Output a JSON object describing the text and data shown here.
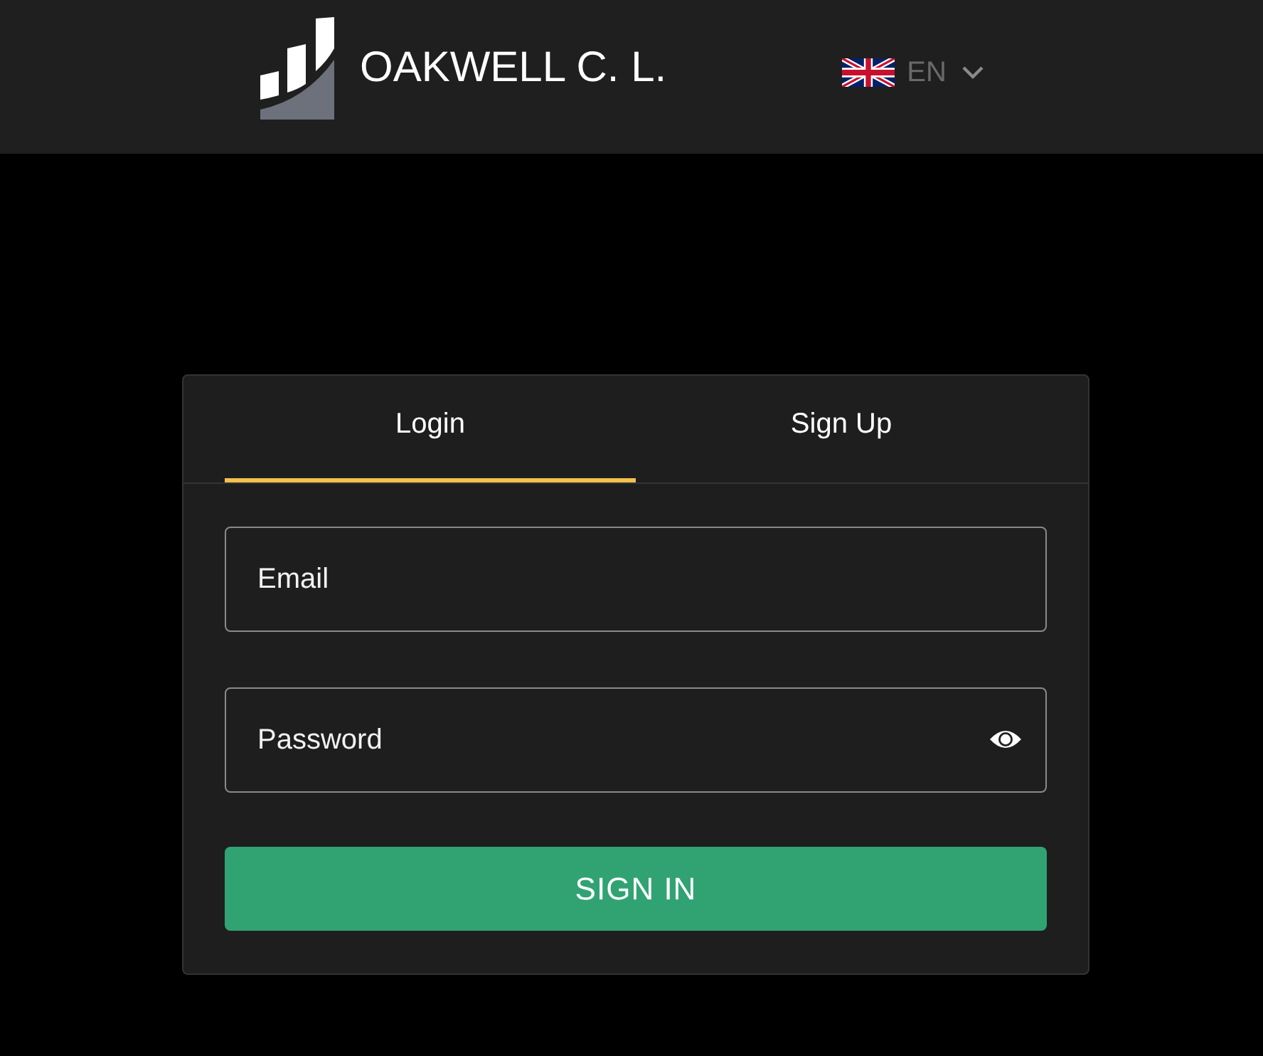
{
  "header": {
    "brand": "OAKWELL C. L.",
    "language": {
      "code": "EN"
    }
  },
  "tabs": [
    {
      "label": "Login",
      "selected": true
    },
    {
      "label": "Sign Up",
      "selected": false
    }
  ],
  "fields": [
    {
      "kind": "text",
      "placeholder": "Email"
    },
    {
      "kind": "password",
      "placeholder": "Password"
    }
  ],
  "submit": "SIGN IN"
}
